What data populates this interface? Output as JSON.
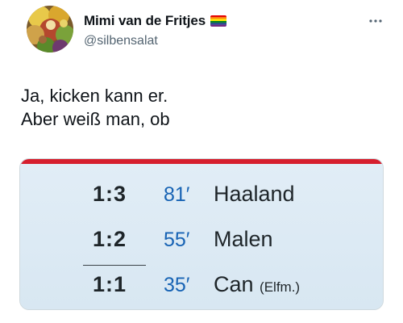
{
  "tweet": {
    "display_name": "Mimi van de Fritjes",
    "handle": "@silbensalat",
    "text_lines": [
      "Ja, kicken kann er.",
      "Aber weiß man, ob"
    ]
  },
  "icons": {
    "flag": "rainbow-flag-icon",
    "more": "more-options-icon",
    "avatar": "avatar-image"
  },
  "scoreboard": {
    "accent_color": "#d61f2e",
    "minute_color": "#1763b4",
    "goals": [
      {
        "score": "1:3",
        "minute": "81′",
        "player": "Haaland",
        "note": ""
      },
      {
        "score": "1:2",
        "minute": "55′",
        "player": "Malen",
        "note": ""
      },
      {
        "score": "1:1",
        "minute": "35′",
        "player": "Can",
        "note": "(Elfm.)"
      }
    ]
  }
}
